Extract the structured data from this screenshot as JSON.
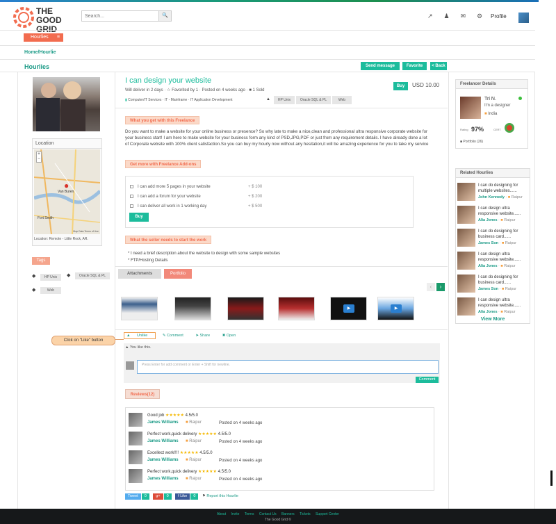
{
  "brand": {
    "logo_text": "THE GOOD GRID"
  },
  "search": {
    "placeholder": "Search..."
  },
  "header": {
    "profile_label": "Profile"
  },
  "nav": {
    "hourlies_button": "Hourlies",
    "breadcrumb": "Home/Hourlie",
    "page_title": "Hourlies"
  },
  "toolbar": {
    "send_message": "Send message",
    "favorite": "Favorite",
    "back": "< Back"
  },
  "location": {
    "title": "Location",
    "caption": "Location: Remote - Little Rock, AR.",
    "map_city1": "Van Buren",
    "map_city2": "Fort Smith",
    "map_footer": "Map Data  Terms of Use"
  },
  "tags": {
    "title": "Tags",
    "items": [
      "HP Unix",
      "Oracle SQL & PL",
      "Web"
    ]
  },
  "gig": {
    "title": "I can design your website",
    "delivery": "Will deliver in 2 days",
    "favorited": "Favorited by 1",
    "posted": "Posted on 4 weeks ago",
    "sold": "1 Sold",
    "category": "Computer/IT Services",
    "subcategory": "IT - Mainframe",
    "subcategory2": "IT Application Development",
    "skill_tabs": [
      "HP Unix",
      "Oracle SQL & PL",
      "Web"
    ],
    "buy_label": "Buy",
    "price": "USD 10.00"
  },
  "freelance_section": {
    "title": "What you get with this Freelance",
    "description": "Do you want to make a website for your online business or presence? So why late to make a nice,clean and professional ultra responsive corporate website for your business start!   I am here to make website for your business form any kind of PSD,JPG,PDF or just from any requirement details. I have already done a lot of Corporate website with 100% client satisfaction.So you can buy my hourly now without any hesitation,it will be amazing experience for you to take my service"
  },
  "addons": {
    "title": "Get more with Freelance Add-ons",
    "items": [
      {
        "label": "I can add more 5 pages in your website",
        "price": "+ $  100"
      },
      {
        "label": "I can add a forum for your website",
        "price": "+ $  200"
      },
      {
        "label": "I can deliver all work in 1 working day",
        "price": "+ $  500"
      }
    ],
    "buy_label": "Buy"
  },
  "needs": {
    "title": "What the seller needs to start the work",
    "items": [
      "* I need a brief description about the website to design with some sample websites",
      "* FTP/Hosting Details"
    ]
  },
  "portfolio_tabs": {
    "attachments": "Attachments",
    "portfolio": "Portfolio"
  },
  "social": {
    "unlike": "Unlike",
    "comment": "Comment",
    "share": "Share",
    "open": "Open",
    "you_like": "You like this."
  },
  "callout": "Click on \"Like\" button",
  "comment_box": {
    "placeholder": "Press Enter for add comment or Enter + Shift for newline.",
    "button": "Comment"
  },
  "reviews": {
    "title": "Reviews(12)",
    "items": [
      {
        "title": "Good job",
        "rating": "4.5/5.0",
        "name": "James Williams",
        "location": "Raipur",
        "posted": "Posted on 4 weeks ago"
      },
      {
        "title": "Perfect work,quick delivery",
        "rating": "4.5/5.0",
        "name": "James Williams",
        "location": "Raipur",
        "posted": "Posted on 4 weeks ago"
      },
      {
        "title": "Excellect work!!!!",
        "rating": "4.5/5.0",
        "name": "James Williams",
        "location": "Raipur",
        "posted": "Posted on 4 weeks ago"
      },
      {
        "title": "Perfect work,quick delivery",
        "rating": "4.5/5.0",
        "name": "James Williams",
        "location": "Raipur",
        "posted": "Posted on 4 weeks ago"
      }
    ]
  },
  "share": {
    "tweet": "Tweet",
    "tweet_count": "0",
    "gplus": "g+",
    "gplus_count": "0",
    "like": "f Like",
    "like_count": "0",
    "report": "Report this Hourlie"
  },
  "freelancer": {
    "panel_title": "Freelancer Details",
    "name": "Tri N.",
    "tagline": "I'm a designer",
    "country": "India",
    "rating_label": "Rating",
    "rating": "97%",
    "cert_label": "CERT",
    "portfolio": "Portfolio (26)"
  },
  "related": {
    "title": "Related  Hourlies",
    "items": [
      {
        "title": "I can do designing for multiple websites......",
        "name": "John Kennedy",
        "location": "Raipur"
      },
      {
        "title": "I can design ultra responsive website......",
        "name": "Alia Jones",
        "location": "Raipur"
      },
      {
        "title": "I can do designing for business card......",
        "name": "James Son",
        "location": "Raipur"
      },
      {
        "title": "I can design ultra responsive website......",
        "name": "Alia Jones",
        "location": "Raipur"
      },
      {
        "title": "I can do designing for business card......",
        "name": "James Son",
        "location": "Raipur"
      },
      {
        "title": "I can design ultra responsive website......",
        "name": "Alia Jones",
        "location": "Raipur"
      }
    ],
    "view_more": "View More"
  },
  "footer": {
    "links": [
      "About",
      "Invite",
      "Terms",
      "Contact Us",
      "Banners",
      "Tickets",
      "Support Center"
    ],
    "copyright": "The Good Grid ©"
  },
  "colors": {
    "accent": "#1cbc9c",
    "orange": "#f26c4f"
  }
}
